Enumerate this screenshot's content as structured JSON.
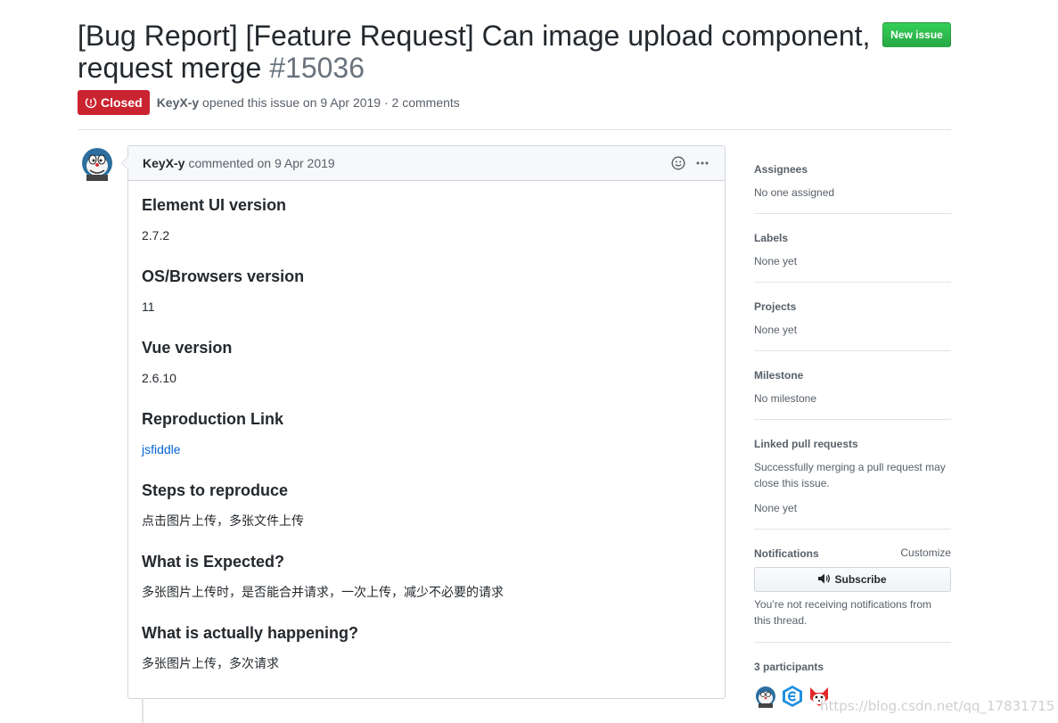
{
  "issue": {
    "title": "[Bug Report] [Feature Request] Can image upload component, request merge",
    "number": "#15036",
    "new_issue_label": "New issue",
    "state": "Closed",
    "author": "KeyX-y",
    "opened_text": "opened this issue on 9 Apr 2019 · 2 comments"
  },
  "comment": {
    "author": "KeyX-y",
    "meta": "commented on 9 Apr 2019",
    "sections": [
      {
        "heading": "Element UI version",
        "text": "2.7.2"
      },
      {
        "heading": "OS/Browsers version",
        "text": "11"
      },
      {
        "heading": "Vue version",
        "text": "2.6.10"
      },
      {
        "heading": "Reproduction Link",
        "text": "jsfiddle"
      },
      {
        "heading": "Steps to reproduce",
        "text": "点击图片上传，多张文件上传"
      },
      {
        "heading": "What is Expected?",
        "text": "多张图片上传时，是否能合并请求，一次上传，减少不必要的请求"
      },
      {
        "heading": "What is actually happening?",
        "text": "多张图片上传，多次请求"
      }
    ]
  },
  "sidebar": {
    "assignees": {
      "heading": "Assignees",
      "value": "No one assigned"
    },
    "labels": {
      "heading": "Labels",
      "value": "None yet"
    },
    "projects": {
      "heading": "Projects",
      "value": "None yet"
    },
    "milestone": {
      "heading": "Milestone",
      "value": "No milestone"
    },
    "linked": {
      "heading": "Linked pull requests",
      "note": "Successfully merging a pull request may close this issue.",
      "value": "None yet"
    },
    "notifications": {
      "heading": "Notifications",
      "customize": "Customize",
      "subscribe": "Subscribe",
      "note": "You’re not receiving notifications from this thread."
    },
    "participants": {
      "heading": "3 participants"
    }
  },
  "watermark": "https://blog.csdn.net/qq_17831715",
  "colors": {
    "closed": "#cb2431",
    "new_issue": "#2ea44f",
    "link": "#0366d6"
  }
}
